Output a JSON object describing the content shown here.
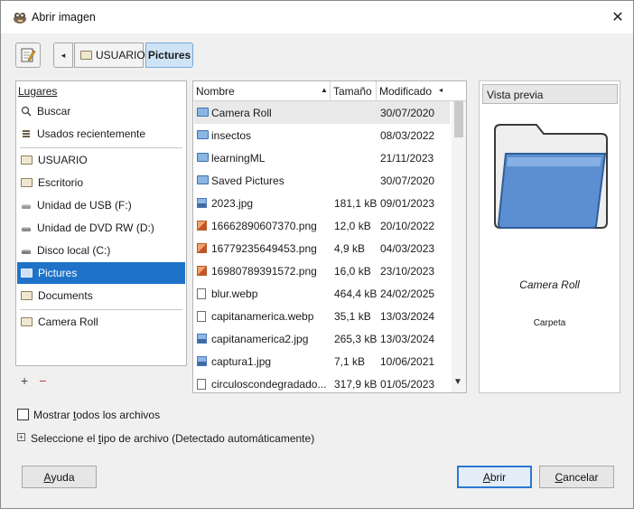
{
  "window": {
    "title": "Abrir imagen",
    "close_glyph": "✕",
    "icon": "gimp-wilber-icon"
  },
  "pathbar": {
    "edit_icon": "edit-location-icon",
    "back_glyph": "◂",
    "crumbs": [
      {
        "label": "USUARIO",
        "icon": "folder-icon",
        "active": false
      },
      {
        "label": "Pictures",
        "active": true
      }
    ]
  },
  "places": {
    "header": "Lugares",
    "items": [
      {
        "label": "Buscar",
        "icon": "search-icon"
      },
      {
        "label": "Usados recientemente",
        "icon": "recent-icon"
      },
      {
        "label": "USUARIO",
        "icon": "folder-icon"
      },
      {
        "label": "Escritorio",
        "icon": "folder-icon"
      },
      {
        "label": "Unidad de USB (F:)",
        "icon": "usb-drive-icon"
      },
      {
        "label": "Unidad de DVD RW (D:)",
        "icon": "dvd-drive-icon"
      },
      {
        "label": "Disco local (C:)",
        "icon": "hard-disk-icon"
      },
      {
        "label": "Pictures",
        "icon": "folder-icon",
        "selected": true
      },
      {
        "label": "Documents",
        "icon": "folder-icon"
      },
      {
        "label": "Camera Roll",
        "icon": "folder-icon"
      }
    ],
    "add_glyph": "+",
    "remove_glyph": "−"
  },
  "files": {
    "columns": {
      "name": "Nombre",
      "size": "Tamaño",
      "modified": "Modificado"
    },
    "rows": [
      {
        "name": "Camera Roll",
        "size": "",
        "date": "30/07/2020",
        "type": "folder"
      },
      {
        "name": "insectos",
        "size": "",
        "date": "08/03/2022",
        "type": "folder"
      },
      {
        "name": "learningML",
        "size": "",
        "date": "21/11/2023",
        "type": "folder"
      },
      {
        "name": "Saved Pictures",
        "size": "",
        "date": "30/07/2020",
        "type": "folder"
      },
      {
        "name": "2023.jpg",
        "size": "181,1 kB",
        "date": "09/01/2023",
        "type": "image"
      },
      {
        "name": "16662890607370.png",
        "size": "12,0 kB",
        "date": "20/10/2022",
        "type": "png"
      },
      {
        "name": "16779235649453.png",
        "size": "4,9 kB",
        "date": "04/03/2023",
        "type": "png"
      },
      {
        "name": "16980789391572.png",
        "size": "16,0 kB",
        "date": "23/10/2023",
        "type": "png"
      },
      {
        "name": "blur.webp",
        "size": "464,4 kB",
        "date": "24/02/2025",
        "type": "doc"
      },
      {
        "name": "capitanamerica.webp",
        "size": "35,1 kB",
        "date": "13/03/2024",
        "type": "doc"
      },
      {
        "name": "capitanamerica2.jpg",
        "size": "265,3 kB",
        "date": "13/03/2024",
        "type": "image"
      },
      {
        "name": "captura1.jpg",
        "size": "7,1 kB",
        "date": "10/06/2021",
        "type": "image"
      },
      {
        "name": "circuloscondegradado...",
        "size": "317,9 kB",
        "date": "01/05/2023",
        "type": "doc"
      }
    ]
  },
  "preview": {
    "header": "Vista previa",
    "name": "Camera Roll",
    "type": "Carpeta"
  },
  "options": {
    "show_all_pre": "Mostrar ",
    "show_all_mn": "t",
    "show_all_post": "odos los archivos",
    "filetype_pre": "Seleccione el ",
    "filetype_mn": "t",
    "filetype_post": "ipo de archivo (Detectado automáticamente)",
    "expander_glyph": "+"
  },
  "buttons": {
    "help_mn": "A",
    "help_rest": "yuda",
    "open_mn": "A",
    "open_rest": "brir",
    "cancel_mn": "C",
    "cancel_rest": "ancelar"
  },
  "colors": {
    "selection": "#1e73c8",
    "default_button_border": "#2b78d0",
    "folder_blue": "#5b8fd1"
  }
}
